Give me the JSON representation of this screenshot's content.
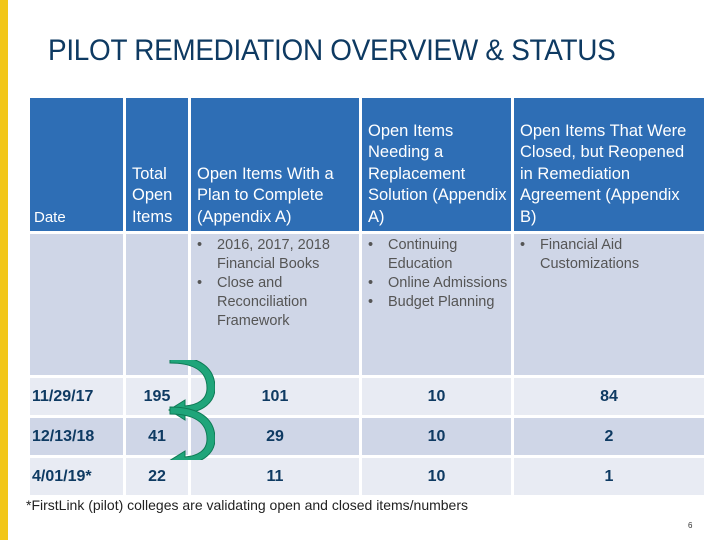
{
  "slide": {
    "title": "PILOT REMEDIATION OVERVIEW & STATUS",
    "accent_color": "#F2C618",
    "header_color": "#2E6EB5",
    "arrow_color": "#1FA57A",
    "page_number": "6"
  },
  "table": {
    "headers": [
      "Date",
      "Total Open Items",
      "Open Items With a Plan to Complete (Appendix A)",
      "Open Items Needing a Replacement Solution (Appendix A)",
      "Open Items That Were Closed, but Reopened in Remediation Agreement (Appendix B)"
    ],
    "bullets": {
      "plan_to_complete": [
        "2016, 2017, 2018 Financial Books",
        "Close and Reconciliation Framework"
      ],
      "replacement_solution": [
        "Continuing Education",
        "Online Admissions",
        "Budget Planning"
      ],
      "reopened": [
        "Financial Aid Customizations"
      ]
    },
    "rows": [
      {
        "date": "11/29/17",
        "total": "195",
        "plan": "101",
        "replacement": "10",
        "reopened": "84"
      },
      {
        "date": "12/13/18",
        "total": "41",
        "plan": "29",
        "replacement": "10",
        "reopened": "2"
      },
      {
        "date": "4/01/19*",
        "total": "22",
        "plan": "11",
        "replacement": "10",
        "reopened": "1"
      }
    ]
  },
  "footnote": "*FirstLink (pilot) colleges are validating open and closed items/numbers"
}
